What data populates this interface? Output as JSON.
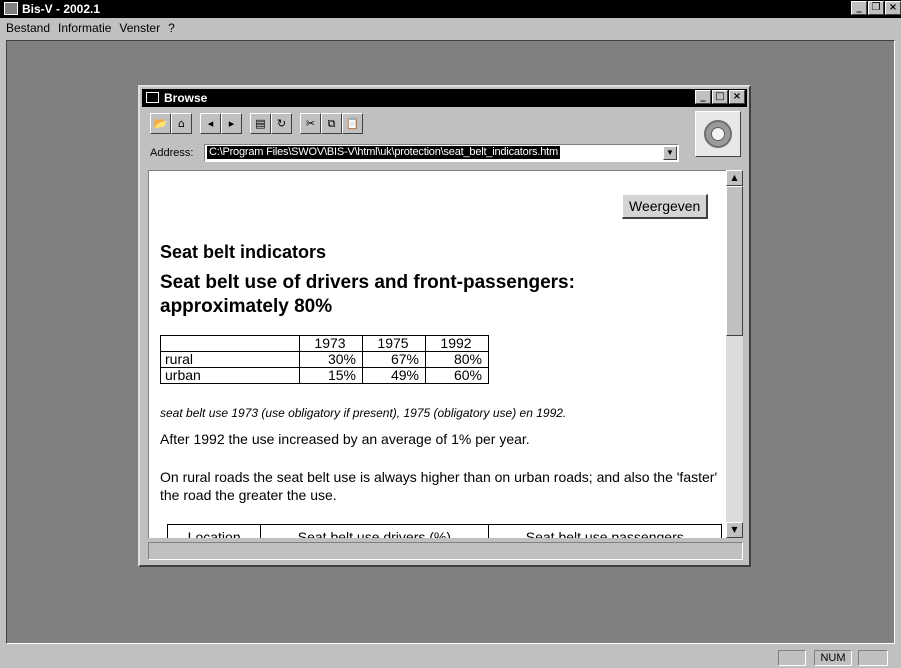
{
  "app": {
    "title": "Bis-V - 2002.1",
    "min": "_",
    "restore": "❐",
    "close": "×"
  },
  "menu": [
    "Bestand",
    "Informatie",
    "Venster",
    "?"
  ],
  "statusbar": {
    "num": "NUM"
  },
  "browse": {
    "title": "Browse",
    "min": "_",
    "max": "□",
    "close": "×",
    "address_label": "Address:",
    "address_value": "C:\\Program Files\\SWOV\\BIS-V\\html\\uk\\protection\\seat_belt_indicators.htm",
    "toolbar_icons": [
      "open-icon",
      "home-icon",
      "back-icon",
      "forward-icon",
      "page-icon",
      "refresh-icon",
      "cut-icon",
      "copy-icon",
      "paste-icon"
    ]
  },
  "page": {
    "button": "Weergeven",
    "heading1": "Seat belt indicators",
    "heading2": "Seat belt use of drivers and front-passengers: approximately 80%",
    "table1": {
      "headers": [
        "",
        "1973",
        "1975",
        "1992"
      ],
      "rows": [
        [
          "rural",
          "30%",
          "67%",
          "80%"
        ],
        [
          "urban",
          "15%",
          "49%",
          "60%"
        ]
      ]
    },
    "note": "seat belt use 1973 (use obligatory if present), 1975 (obligatory use) en 1992.",
    "para1": "After 1992 the use increased by an average of 1% per year.",
    "para2": "On rural roads the seat belt use is always higher than on urban roads; and also the 'faster' the road the greater the use.",
    "table2_headers": [
      "Location",
      "Seat belt use drivers (%)",
      "Seat belt use passengers"
    ]
  }
}
